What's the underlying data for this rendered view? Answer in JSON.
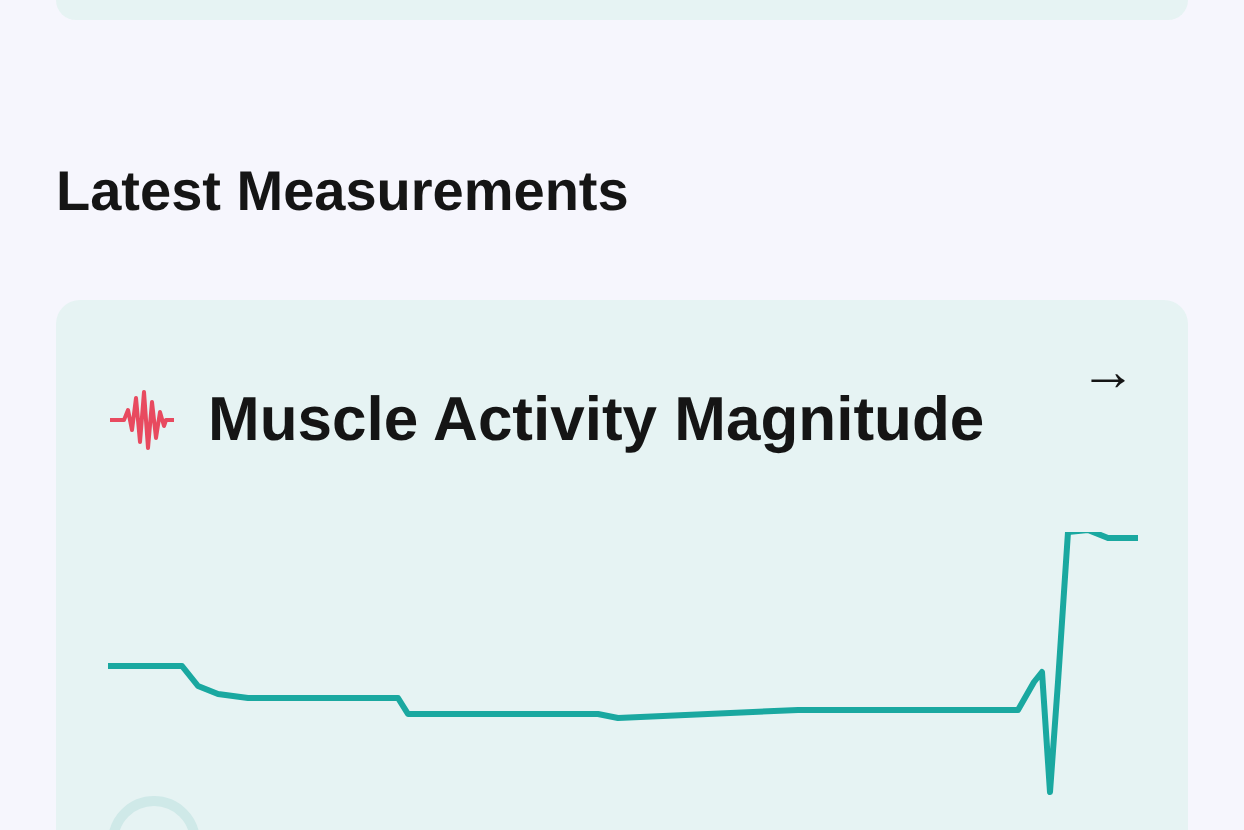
{
  "section": {
    "title": "Latest Measurements"
  },
  "measurement_card": {
    "title": "Muscle Activity Magnitude",
    "arrow": "→"
  }
}
